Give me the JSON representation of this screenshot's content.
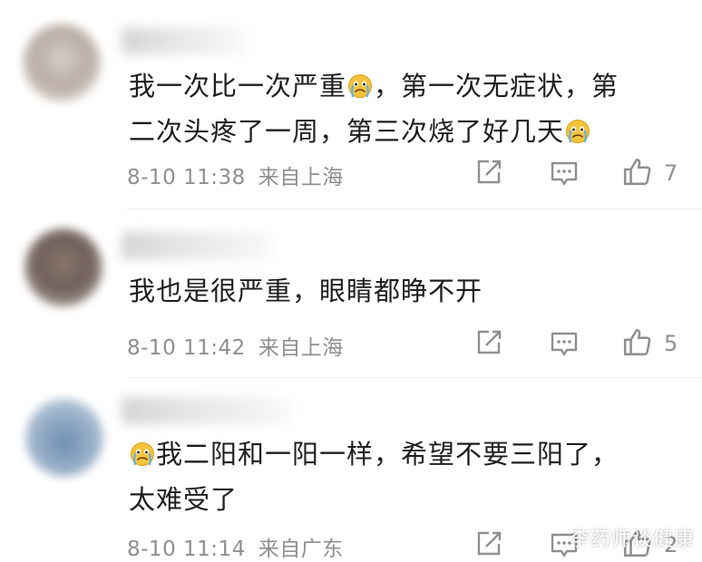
{
  "comments": [
    {
      "lines": [
        [
          "我一次比一次严重",
          "emoji",
          "，第一次无症状，第"
        ],
        [
          "二次头疼了一周，第三次烧了好几天",
          "emoji"
        ]
      ],
      "time": "8-10 11:38",
      "location": "来自上海",
      "likes": "7"
    },
    {
      "lines": [
        [
          "我也是很严重，眼睛都睁不开"
        ]
      ],
      "time": "8-10 11:42",
      "location": "来自上海",
      "likes": "5"
    },
    {
      "lines": [
        [
          "emoji",
          "我二阳和一阳一样，希望不要三阳了，"
        ],
        [
          "太难受了"
        ]
      ],
      "time": "8-10 11:14",
      "location": "来自广东",
      "likes": "2"
    }
  ],
  "icons": {
    "share": "share-icon",
    "reply": "comment-icon",
    "like": "thumbs-up-icon",
    "emoji": "crying-face-emoji"
  },
  "watermark": "李药师谈健康",
  "colors": {
    "text": "#1e1e1e",
    "meta": "#8f8f8f",
    "divider": "#ebebeb",
    "emoji": "#f5c33b"
  }
}
